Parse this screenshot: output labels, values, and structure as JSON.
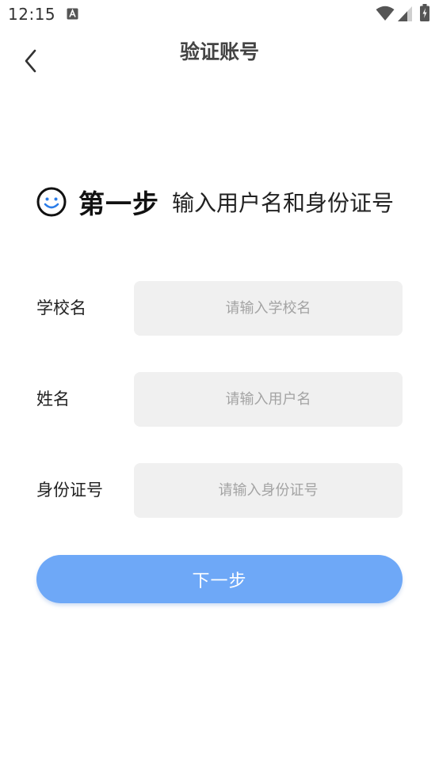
{
  "status_bar": {
    "time": "12:15",
    "notification_icon": "text-a-notification-icon",
    "wifi_icon": "wifi-icon",
    "signal_icon": "cell-signal-icon",
    "battery_icon": "battery-charging-icon"
  },
  "header": {
    "back_icon": "chevron-left-icon",
    "title": "验证账号"
  },
  "step": {
    "icon": "smile-icon",
    "label": "第一步",
    "description": "输入用户名和身份证号"
  },
  "form": {
    "fields": [
      {
        "label": "学校名",
        "value": "",
        "placeholder": "请输入学校名"
      },
      {
        "label": "姓名",
        "value": "",
        "placeholder": "请输入用户名"
      },
      {
        "label": "身份证号",
        "value": "",
        "placeholder": "请输入身份证号"
      }
    ],
    "next_label": "下一步"
  },
  "colors": {
    "accent": "#6ea8f7",
    "input_background": "#f0f0f0",
    "placeholder": "#a3a3a3",
    "title": "#444444"
  }
}
